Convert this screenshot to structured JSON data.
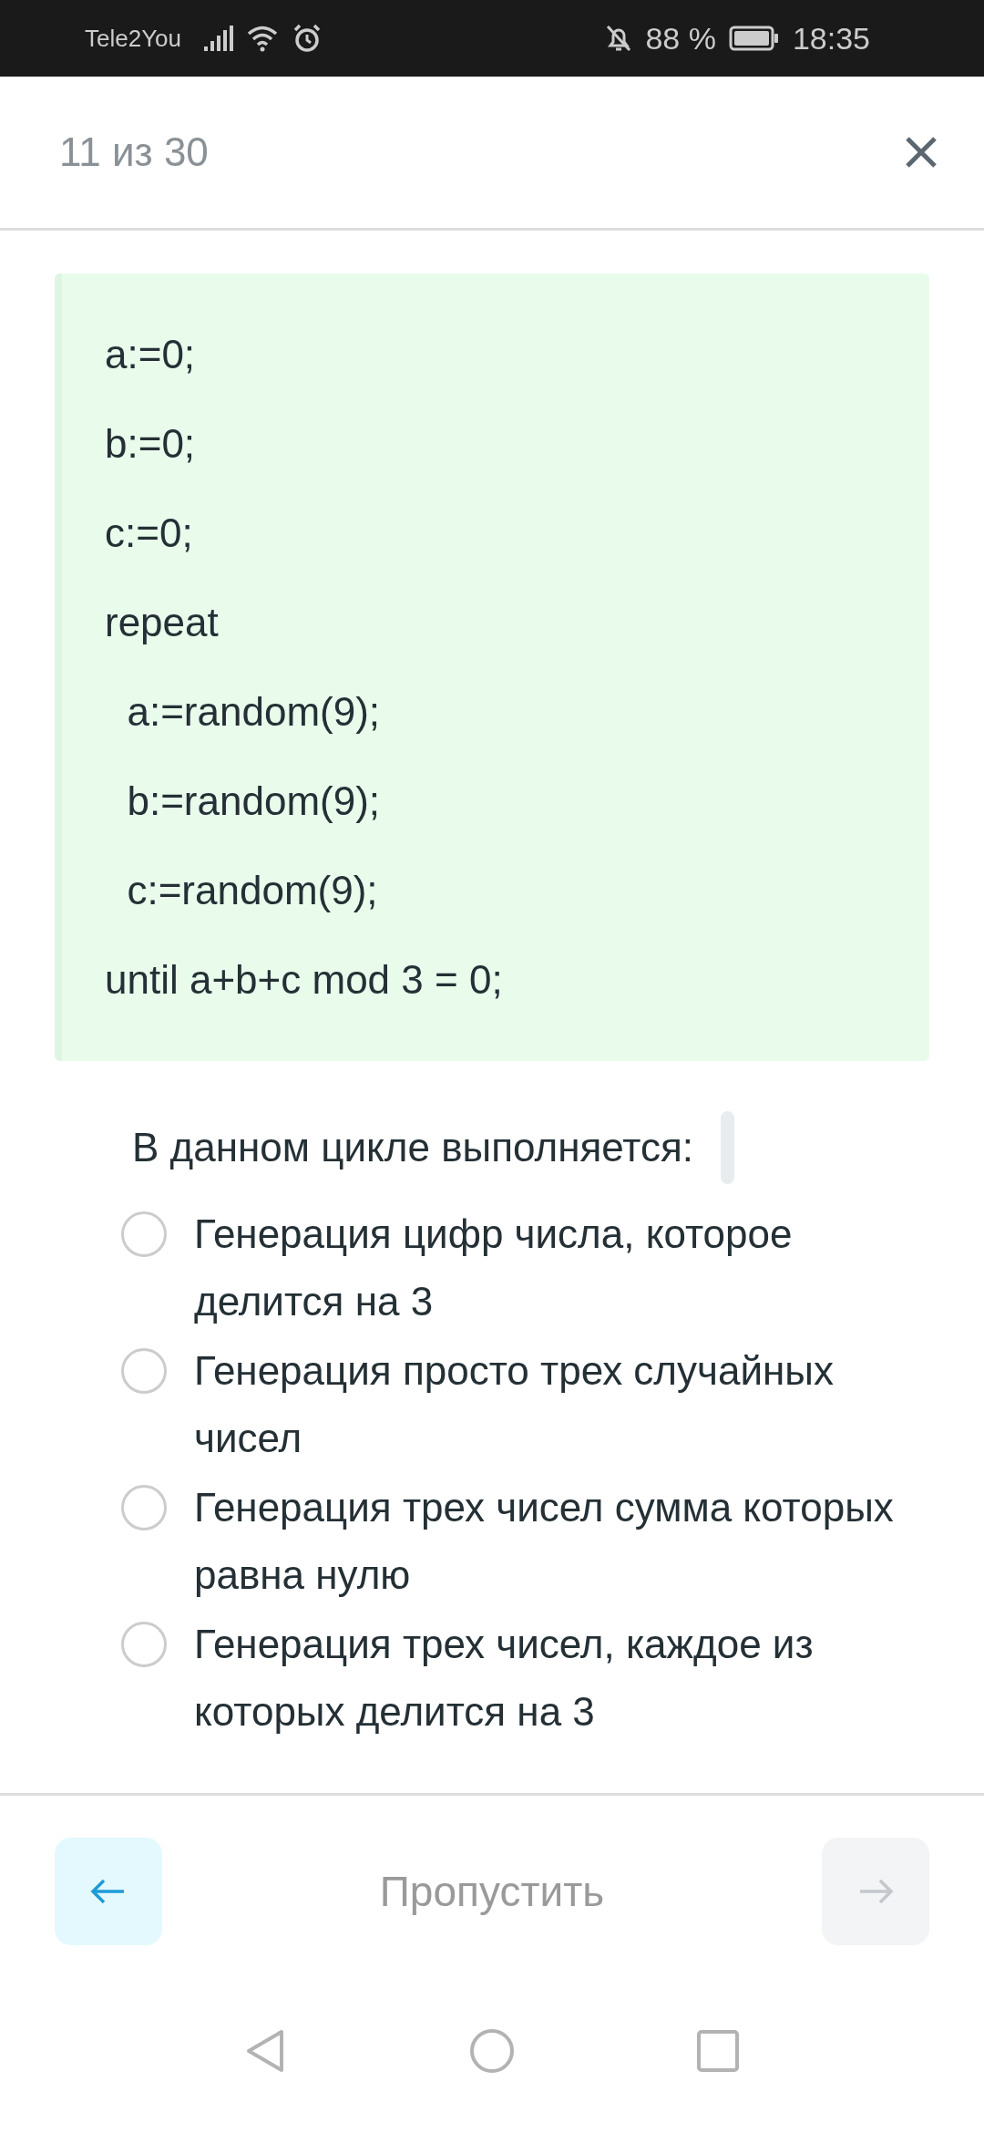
{
  "status_bar": {
    "carrier": "Tele2You",
    "battery": "88 %",
    "time": "18:35"
  },
  "header": {
    "progress": "11 из 30"
  },
  "code_lines": [
    "a:=0;",
    "b:=0;",
    "c:=0;",
    "repeat",
    "  a:=random(9);",
    "  b:=random(9);",
    "  c:=random(9);",
    "until a+b+c mod 3 = 0;"
  ],
  "question": "В данном цикле выполняется:",
  "options": [
    {
      "label": "Генерация цифр числа, которое делится на 3",
      "selected": false
    },
    {
      "label": "Генерация просто трех случайных чисел",
      "selected": false
    },
    {
      "label": "Генерация трех чисел сумма которых равна нулю",
      "selected": false
    },
    {
      "label": "Генерация трех чисел, каждое из которых делится на 3",
      "selected": false
    }
  ],
  "footer": {
    "back": {
      "disabled": false
    },
    "skip": "Пропустить",
    "next": {
      "disabled": true
    }
  }
}
